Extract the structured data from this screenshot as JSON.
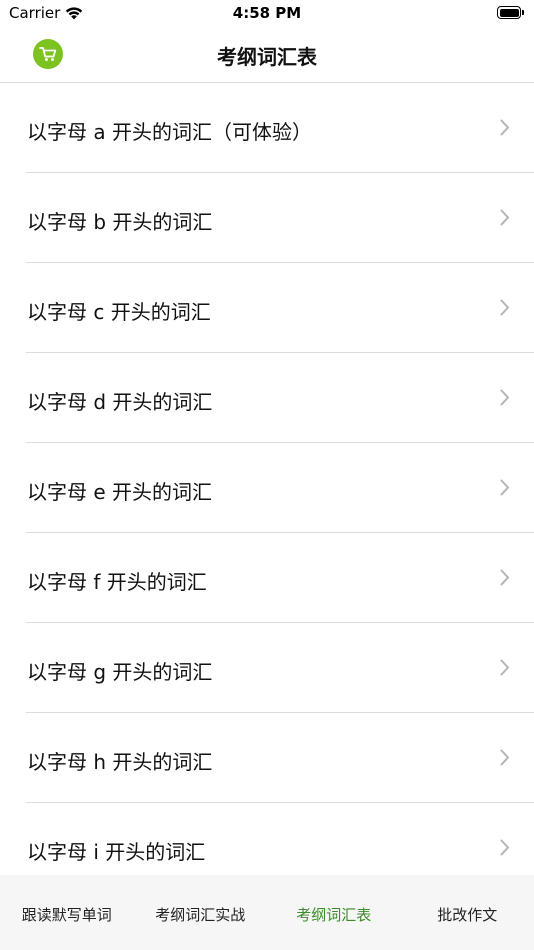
{
  "status_bar": {
    "carrier": "Carrier",
    "time": "4:58 PM"
  },
  "nav": {
    "title": "考纲词汇表",
    "cart_icon": "shopping-cart-icon",
    "cart_color": "#7cc221"
  },
  "list": {
    "items": [
      {
        "label": "以字母 a 开头的词汇（可体验）"
      },
      {
        "label": "以字母 b 开头的词汇"
      },
      {
        "label": "以字母 c 开头的词汇"
      },
      {
        "label": "以字母 d 开头的词汇"
      },
      {
        "label": "以字母 e 开头的词汇"
      },
      {
        "label": "以字母 f 开头的词汇"
      },
      {
        "label": "以字母 g 开头的词汇"
      },
      {
        "label": "以字母 h 开头的词汇"
      },
      {
        "label": "以字母 i 开头的词汇"
      }
    ]
  },
  "tab_bar": {
    "tabs": [
      {
        "label": "跟读默写单词",
        "active": false
      },
      {
        "label": "考纲词汇实战",
        "active": false
      },
      {
        "label": "考纲词汇表",
        "active": true
      },
      {
        "label": "批改作文",
        "active": false
      }
    ],
    "active_color": "#3d8b2c"
  }
}
